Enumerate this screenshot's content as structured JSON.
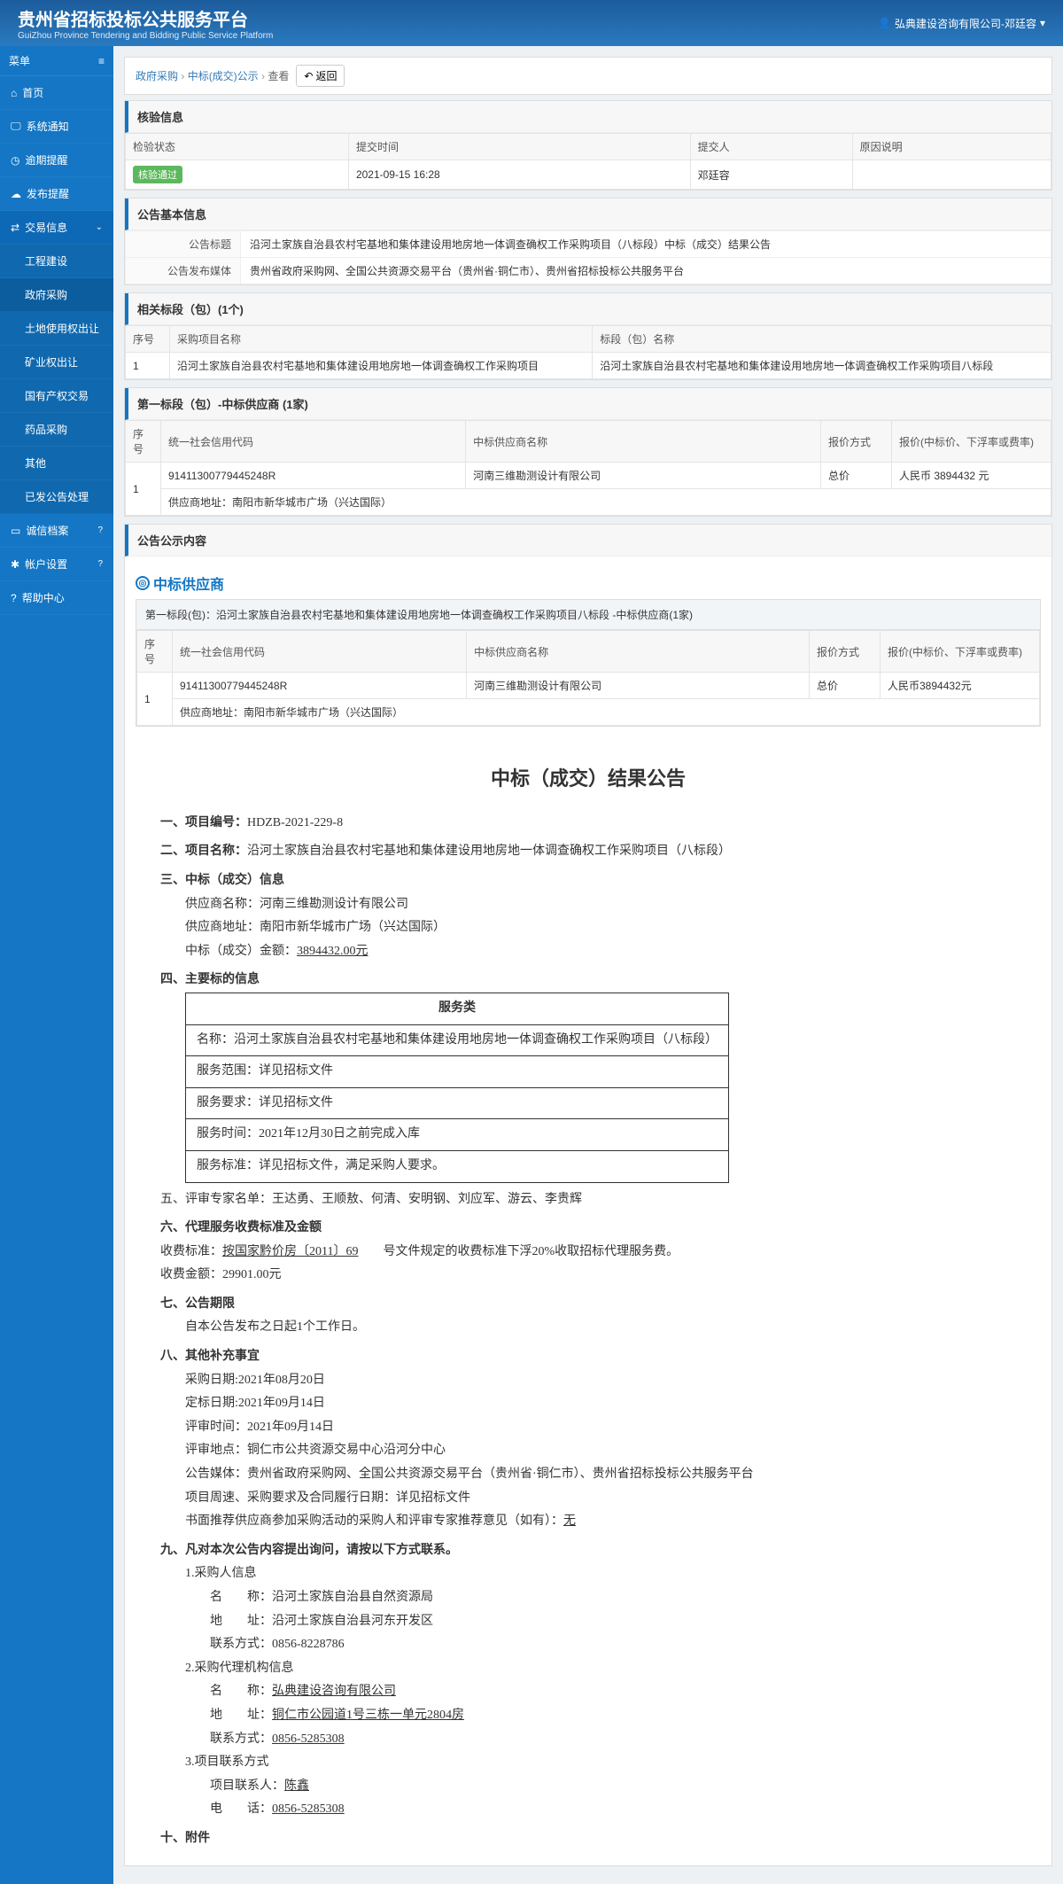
{
  "header": {
    "title": "贵州省招标投标公共服务平台",
    "subtitle": "GuiZhou Province Tendering and Bidding Public Service Platform",
    "user": "弘典建设咨询有限公司-邓廷容"
  },
  "sidebar": {
    "heading": "菜单",
    "items": [
      {
        "icon": "home",
        "label": "首页"
      },
      {
        "icon": "monitor",
        "label": "系统通知"
      },
      {
        "icon": "clock",
        "label": "逾期提醒"
      },
      {
        "icon": "bell",
        "label": "发布提醒"
      },
      {
        "icon": "swap",
        "label": "交易信息",
        "active": true,
        "expanded": true,
        "children": [
          {
            "label": "工程建设"
          },
          {
            "label": "政府采购",
            "active": true
          },
          {
            "label": "土地使用权出让"
          },
          {
            "label": "矿业权出让"
          },
          {
            "label": "国有产权交易"
          },
          {
            "label": "药品采购"
          },
          {
            "label": "其他"
          },
          {
            "label": "已发公告处理"
          }
        ]
      },
      {
        "icon": "id",
        "label": "诚信档案",
        "info": true
      },
      {
        "icon": "gear",
        "label": "帐户设置",
        "info": true
      },
      {
        "icon": "help",
        "label": "帮助中心"
      }
    ]
  },
  "breadcrumb": {
    "items": [
      "政府采购",
      "中标(成交)公示",
      "查看"
    ],
    "return": "返回"
  },
  "panels": {
    "verify": {
      "title": "核验信息",
      "cols": [
        "检验状态",
        "提交时间",
        "提交人",
        "原因说明"
      ],
      "row": {
        "status": "核验通过",
        "time": "2021-09-15 16:28",
        "by": "邓廷容",
        "reason": ""
      }
    },
    "basic": {
      "title": "公告基本信息",
      "rows": [
        {
          "k": "公告标题",
          "v": "沿河土家族自治县农村宅基地和集体建设用地房地一体调查确权工作采购项目（八标段）中标（成交）结果公告"
        },
        {
          "k": "公告发布媒体",
          "v": "贵州省政府采购网、全国公共资源交易平台（贵州省·铜仁市）、贵州省招标投标公共服务平台"
        }
      ]
    },
    "section": {
      "title": "相关标段（包）(1个)",
      "cols": [
        "序号",
        "采购项目名称",
        "标段（包）名称"
      ],
      "rows": [
        [
          "1",
          "沿河土家族自治县农村宅基地和集体建设用地房地一体调查确权工作采购项目",
          "沿河土家族自治县农村宅基地和集体建设用地房地一体调查确权工作采购项目八标段"
        ]
      ]
    },
    "winner": {
      "title": "第一标段（包）-中标供应商 (1家)",
      "cols": [
        "序号",
        "统一社会信用代码",
        "中标供应商名称",
        "报价方式",
        "报价(中标价、下浮率或费率)"
      ],
      "row": {
        "no": "1",
        "code": "91411300779445248R",
        "name": "河南三维勘测设计有限公司",
        "method": "总价",
        "price": "人民币 3894432 元",
        "addrLabel": "供应商地址：",
        "addr": "南阳市新华城市广场（兴达国际）"
      }
    },
    "content": {
      "title": "公告公示内容"
    }
  },
  "innerCard": {
    "heading": "中标供应商",
    "sub": "第一标段(包)：沿河土家族自治县农村宅基地和集体建设用地房地一体调查确权工作采购项目八标段 -中标供应商(1家)",
    "cols": [
      "序号",
      "统一社会信用代码",
      "中标供应商名称",
      "报价方式",
      "报价(中标价、下浮率或费率)"
    ],
    "row": {
      "no": "1",
      "code": "91411300779445248R",
      "name": "河南三维勘测设计有限公司",
      "method": "总价",
      "price": "人民币3894432元",
      "addrLabel": "供应商地址：",
      "addr": "南阳市新华城市广场（兴达国际）"
    }
  },
  "article": {
    "title": "中标（成交）结果公告",
    "one_label": "一、项目编号：",
    "one_val": "HDZB-2021-229-8",
    "two_label": "二、项目名称：",
    "two_val": "沿河土家族自治县农村宅基地和集体建设用地房地一体调查确权工作采购项目（八标段）",
    "three_label": "三、中标（成交）信息",
    "three_lines": [
      "供应商名称：河南三维勘测设计有限公司",
      "供应商地址：南阳市新华城市广场（兴达国际）"
    ],
    "three_amount_label": "中标（成交）金额：",
    "three_amount_val": "3894432.00元",
    "four_label": "四、主要标的信息",
    "bid_table": {
      "head": "服务类",
      "rows": [
        "名称：沿河土家族自治县农村宅基地和集体建设用地房地一体调查确权工作采购项目（八标段）",
        "服务范围：详见招标文件",
        "服务要求：详见招标文件",
        "服务时间：2021年12月30日之前完成入库",
        "服务标准：详见招标文件，满足采购人要求。"
      ]
    },
    "five": "五、评审专家名单：王达勇、王顺敖、何清、安明钢、刘应军、游云、李贵辉",
    "six_label": "六、代理服务收费标准及金额",
    "six_fee_label": "收费标准：",
    "six_fee_link": "按国家黔价房〔2011〕69",
    "six_fee_tail": "　　号文件规定的收费标准下浮20%收取招标代理服务费。",
    "six_amount": "收费金额：29901.00元",
    "seven_label": "七、公告期限",
    "seven_val": "自本公告发布之日起1个工作日。",
    "eight_label": "八、其他补充事宜",
    "eight_lines": [
      "采购日期:2021年08月20日",
      "定标日期:2021年09月14日",
      "评审时间：2021年09月14日",
      "评审地点：铜仁市公共资源交易中心沿河分中心",
      "公告媒体：贵州省政府采购网、全国公共资源交易平台（贵州省·铜仁市）、贵州省招标投标公共服务平台",
      "项目周速、采购要求及合同履行日期：详见招标文件"
    ],
    "eight_last_label": "书面推荐供应商参加采购活动的采购人和评审专家推荐意见（如有）：",
    "eight_last_link": "无",
    "nine_label": "九、凡对本次公告内容提出询问，请按以下方式联系。",
    "nine": {
      "b1": "1.采购人信息",
      "b1a": "名　　称：沿河土家族自治县自然资源局",
      "b1b": "地　　址：沿河土家族自治县河东开发区",
      "b1c": "联系方式：0856-8228786",
      "b2": "2.采购代理机构信息",
      "b2a_label": "名　　称：",
      "b2a_link": "弘典建设咨询有限公司",
      "b2b_label": "地　　址：",
      "b2b_link": "铜仁市公园道1号三栋一单元2804房",
      "b2c_label": "联系方式：",
      "b2c_link": "0856-5285308",
      "b3": "3.项目联系方式",
      "b3a_label": "项目联系人：",
      "b3a_link": "陈鑫",
      "b3b_label": "电　　话：",
      "b3b_link": "0856-5285308"
    },
    "ten": "十、附件"
  }
}
